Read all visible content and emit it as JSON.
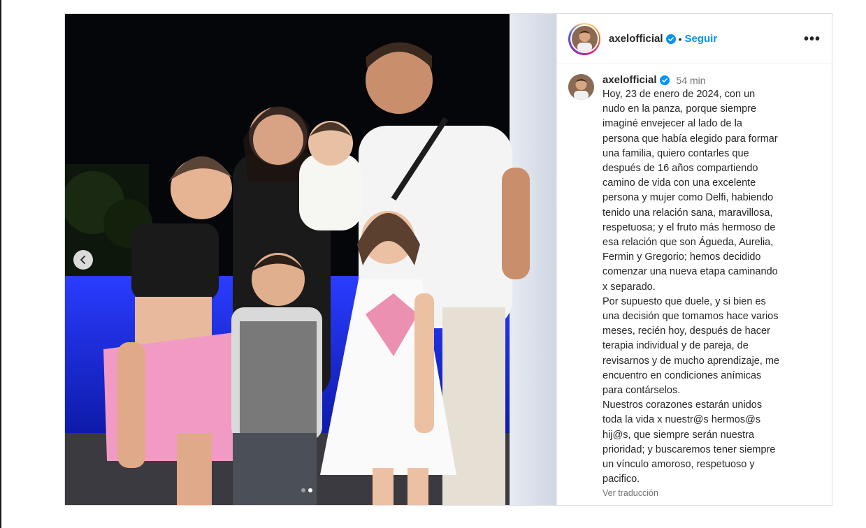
{
  "post": {
    "username": "axelofficial",
    "follow_label": "Seguir",
    "separator": "•",
    "more_label": "•••",
    "verified_icon": "verified-badge-icon",
    "comment": {
      "username": "axelofficial",
      "time": "54 min",
      "caption": "Hoy, 23 de enero de 2024, con un\nnudo en la panza, porque siempre\nimaginé envejecer al lado de la\npersona que había elegido para formar\nuna familia, quiero contarles que\ndespués de 16 años compartiendo\ncamino de vida con una excelente\npersona y mujer como Delfi, habiendo\ntenido una relación sana, maravillosa,\nrespetuosa; y el fruto más hermoso de\nesa relación que son Águeda, Aurelia,\nFermin y Gregorio; hemos decidido\ncomenzar una nueva etapa caminando\nx separado.\nPor supuesto que duele, y si bien es\nuna decisión que tomamos hace varios\nmeses, recién hoy, después de hacer\nterapia individual y de pareja, de\nrevisarnos y de mucho aprendizaje, me\nencuentro en condiciones anímicas\npara contárselos.\nNuestros corazones estarán unidos\ntoda la vida x nuestr@s hermos@s\nhij@s, que siempre serán nuestra\nprioridad; y buscaremos tener siempre\nun vínculo amoroso, respetuoso y\npacifico.",
      "translate_label": "Ver traducción"
    },
    "carousel": {
      "slides": 2,
      "active": 2
    }
  },
  "colors": {
    "follow": "#0095f6",
    "verified": "#0095f6",
    "muted": "#737373",
    "text": "#262626",
    "border": "#dbdbdb"
  }
}
